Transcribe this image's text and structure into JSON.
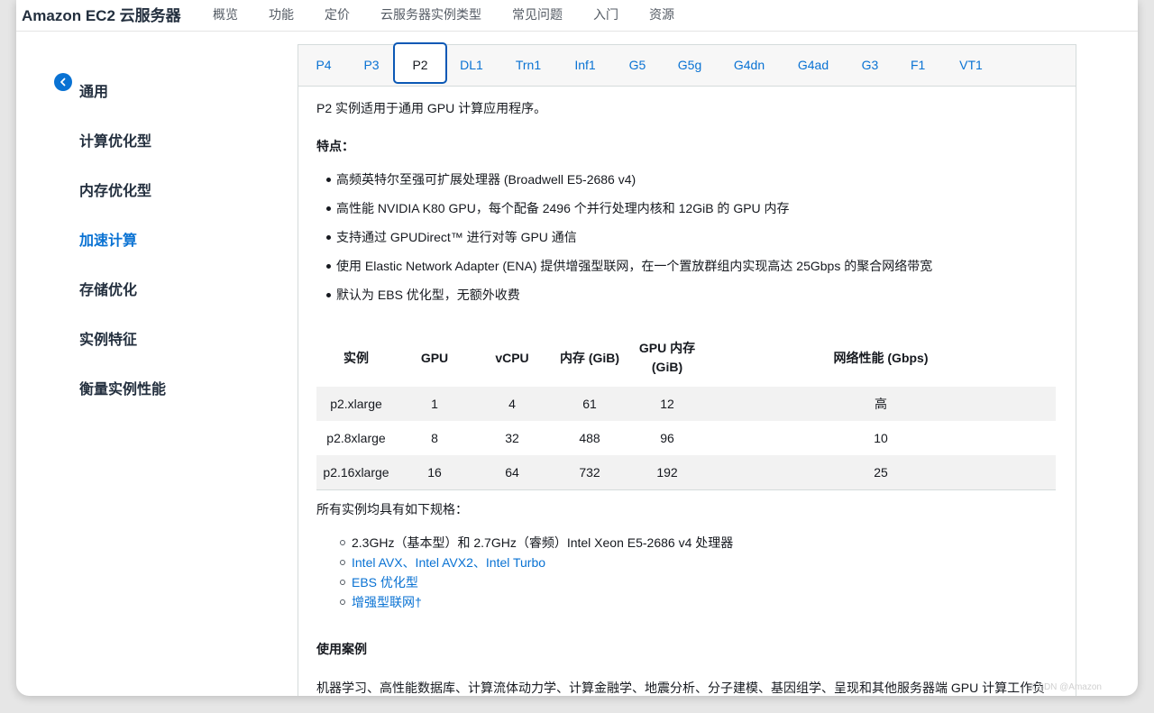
{
  "header": {
    "product_title": "Amazon EC2 云服务器",
    "nav": [
      "概览",
      "功能",
      "定价",
      "云服务器实例类型",
      "常见问题",
      "入门",
      "资源"
    ]
  },
  "sidebar": {
    "back_icon": "chevron-left-icon",
    "items": [
      {
        "label": "通用",
        "active": false
      },
      {
        "label": "计算优化型",
        "active": false
      },
      {
        "label": "内存优化型",
        "active": false
      },
      {
        "label": "加速计算",
        "active": true
      },
      {
        "label": "存储优化",
        "active": false
      },
      {
        "label": "实例特征",
        "active": false
      },
      {
        "label": "衡量实例性能",
        "active": false
      }
    ]
  },
  "tabs": [
    {
      "label": "P4",
      "active": false
    },
    {
      "label": "P3",
      "active": false
    },
    {
      "label": "P2",
      "active": true
    },
    {
      "label": "DL1",
      "active": false
    },
    {
      "label": "Trn1",
      "active": false
    },
    {
      "label": "Inf1",
      "active": false
    },
    {
      "label": "G5",
      "active": false
    },
    {
      "label": "G5g",
      "active": false
    },
    {
      "label": "G4dn",
      "active": false
    },
    {
      "label": "G4ad",
      "active": false
    },
    {
      "label": "G3",
      "active": false
    },
    {
      "label": "F1",
      "active": false
    },
    {
      "label": "VT1",
      "active": false
    }
  ],
  "content": {
    "intro": "P2 实例适用于通用 GPU 计算应用程序。",
    "features_label": "特点：",
    "features": [
      "高频英特尔至强可扩展处理器 (Broadwell E5-2686 v4)",
      "高性能 NVIDIA K80 GPU，每个配备 2496 个并行处理内核和 12GiB 的 GPU 内存",
      "支持通过 GPUDirect™ 进行对等 GPU 通信",
      "使用 Elastic Network Adapter (ENA) 提供增强型联网，在一个置放群组内实现高达 25Gbps 的聚合网络带宽",
      "默认为 EBS 优化型，无额外收费"
    ],
    "table": {
      "headers": [
        "实例",
        "GPU",
        "vCPU",
        "内存 (GiB)",
        "GPU 内存 (GiB)",
        "网络性能 (Gbps)"
      ],
      "rows": [
        [
          "p2.xlarge",
          "1",
          "4",
          "61",
          "12",
          "高"
        ],
        [
          "p2.8xlarge",
          "8",
          "32",
          "488",
          "96",
          "10"
        ],
        [
          "p2.16xlarge",
          "16",
          "64",
          "732",
          "192",
          "25"
        ]
      ]
    },
    "all_specs_label": "所有实例均具有如下规格：",
    "specs": [
      {
        "text": "2.3GHz（基本型）和 2.7GHz（睿频）Intel Xeon E5-2686 v4 处理器",
        "link": false
      },
      {
        "text": "Intel AVX、Intel AVX2、Intel Turbo",
        "link": true
      },
      {
        "text": "EBS 优化型",
        "link": true
      },
      {
        "text": "增强型联网†",
        "link": true
      }
    ],
    "use_cases_title": "使用案例",
    "use_cases_text": "机器学习、高性能数据库、计算流体动力学、计算金融学、地震分析、分子建模、基因组学、呈现和其他服务器端 GPU 计算工作负"
  },
  "watermark": "CSDN @Amazon"
}
